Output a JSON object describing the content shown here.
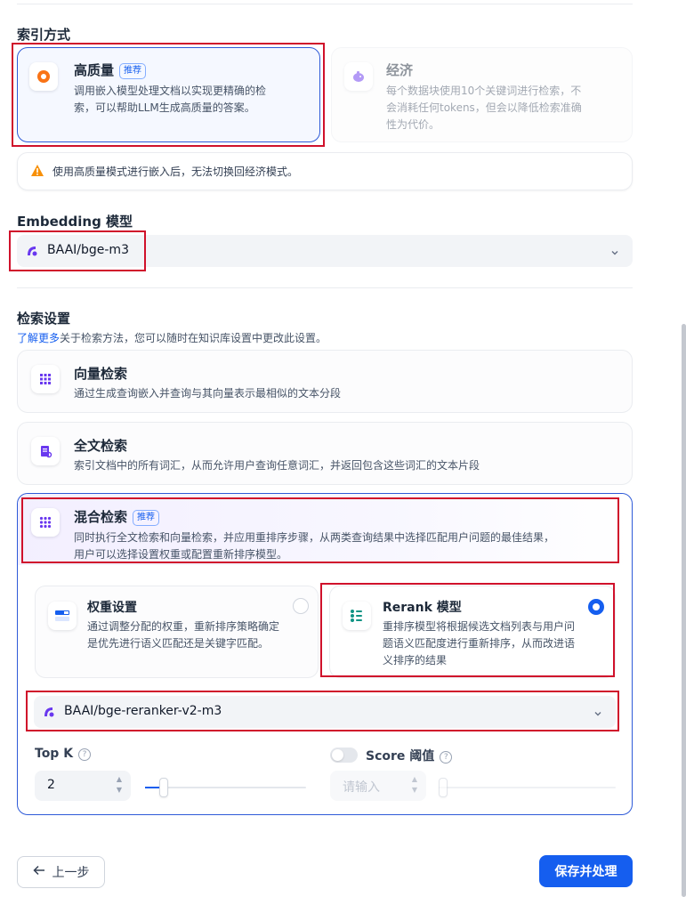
{
  "index_mode": {
    "title": "索引方式",
    "high_quality": {
      "label": "高质量",
      "badge": "推荐",
      "desc_line1": "调用嵌入模型处理文档以实现更精确的检",
      "desc_line2": "索，可以帮助LLM生成高质量的答案。"
    },
    "economy": {
      "label": "经济",
      "desc_line1": "每个数据块使用10个关键词进行检索，不",
      "desc_line2": "会消耗任何tokens，但会以降低检索准确",
      "desc_line3": "性为代价。"
    },
    "warning": "使用高质量模式进行嵌入后，无法切换回经济模式。"
  },
  "embedding": {
    "title": "Embedding 模型",
    "model": "BAAI/bge-m3"
  },
  "retrieval": {
    "title": "检索设置",
    "learn_more": "了解更多",
    "subtitle": "关于检索方法，您可以随时在知识库设置中更改此设置。",
    "vector": {
      "label": "向量检索",
      "desc": "通过生成查询嵌入并查询与其向量表示最相似的文本分段"
    },
    "fulltext": {
      "label": "全文检索",
      "desc": "索引文档中的所有词汇，从而允许用户查询任意词汇，并返回包含这些词汇的文本片段"
    },
    "hybrid": {
      "label": "混合检索",
      "badge": "推荐",
      "desc_line1": "同时执行全文检索和向量检索，并应用重排序步骤，从两类查询结果中选择匹配用户问题的最佳结果，",
      "desc_line2": "用户可以选择设置权重或配置重新排序模型。",
      "weight": {
        "label": "权重设置",
        "desc_line1": "通过调整分配的权重，重新排序策略确定",
        "desc_line2": "是优先进行语义匹配还是关键字匹配。"
      },
      "rerank": {
        "label": "Rerank 模型",
        "desc_line1": "重排序模型将根据候选文档列表与用户问",
        "desc_line2": "题语义匹配度进行重新排序，从而改进语",
        "desc_line3": "义排序的结果"
      },
      "rerank_model": "BAAI/bge-reranker-v2-m3",
      "top_k": {
        "label": "Top K",
        "value": "2",
        "slider_fraction": 0.0
      },
      "score": {
        "label": "Score 阈值",
        "placeholder": "请输入",
        "enabled": false
      }
    }
  },
  "footer": {
    "back": "上一步",
    "save": "保存并处理"
  },
  "colors": {
    "primary": "#155eef",
    "highlight": "#d0112b",
    "icon_orange": "#f97316",
    "icon_purple": "#6938ef",
    "icon_teal": "#0e9384"
  }
}
